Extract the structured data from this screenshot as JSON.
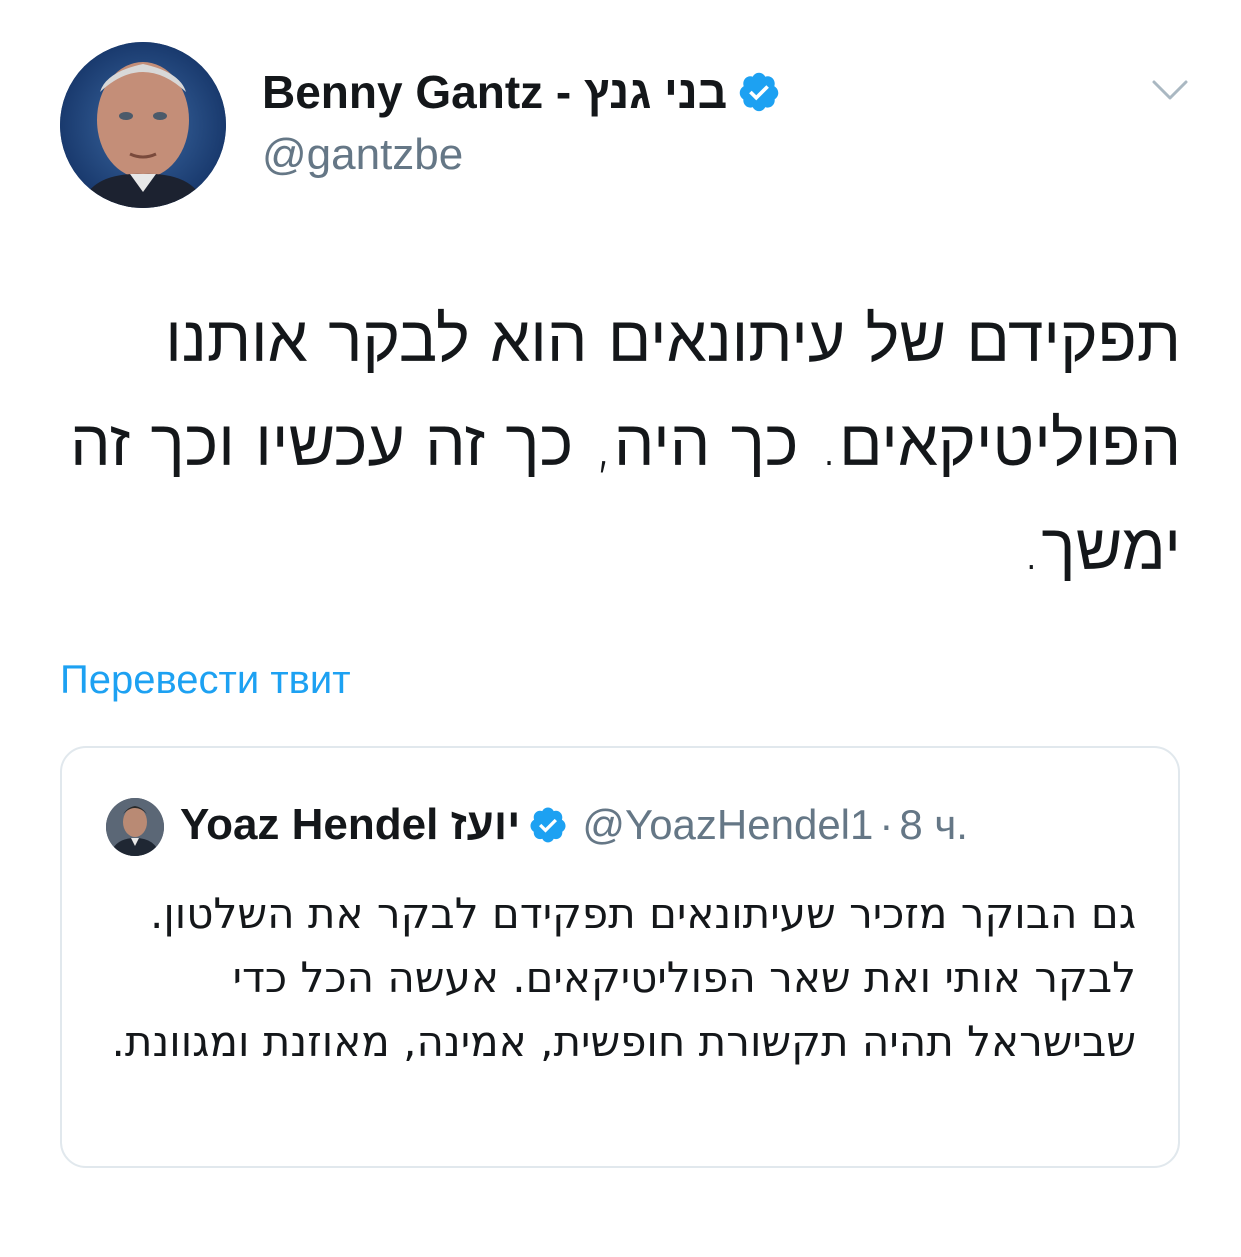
{
  "author": {
    "name": "Benny Gantz - בני גנץ",
    "handle": "@gantzbe",
    "verified": true
  },
  "tweet": {
    "text": "תפקידם של עיתונאים הוא לבקר אותנו הפוליטיקאים. כך היה, כך זה עכשיו וכך זה ימשך."
  },
  "actions": {
    "translate_label": "Перевести твит"
  },
  "quoted": {
    "name": "Yoaz Hendel יועז",
    "handle": "@YoazHendel1",
    "separator": "·",
    "time": "8 ч.",
    "verified": true,
    "text": "גם הבוקר מזכיר שעיתונאים תפקידם לבקר את השלטון. לבקר אותי ואת שאר הפוליטיקאים. אעשה הכל כדי שבישראל תהיה תקשורת חופשית, אמינה, מאוזנת ומגוונת."
  },
  "colors": {
    "accent": "#1da1f2",
    "secondary_text": "#657786",
    "border": "#e1e8ed"
  },
  "icons": {
    "verified": "verified-badge-icon",
    "menu": "chevron-down-icon"
  }
}
